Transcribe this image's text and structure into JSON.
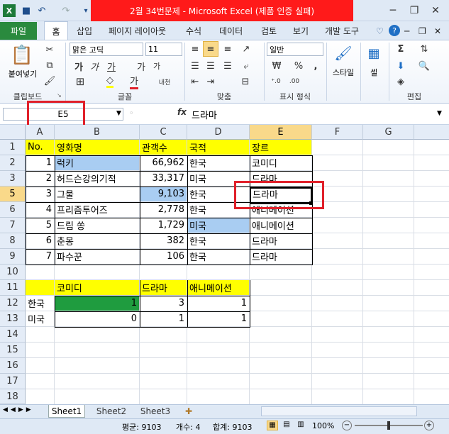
{
  "window": {
    "title": "2월 34번문제  -  Microsoft Excel (제품 인증 실패)",
    "min": "─",
    "restore": "❐",
    "close": "✕"
  },
  "qat": {
    "icons": [
      "excel-icon",
      "save-icon",
      "undo-icon",
      "redo-icon"
    ]
  },
  "tabs": {
    "file": "파일",
    "home": "홈",
    "insert": "삽입",
    "layout": "페이지 레이아웃",
    "formula": "수식",
    "data": "데이터",
    "review": "검토",
    "view": "보기",
    "dev": "개발 도구"
  },
  "ribbon": {
    "clipboard": {
      "paste": "붙여넣기",
      "label": "클립보드"
    },
    "font": {
      "name": "맑은 고딕",
      "size": "11",
      "bold": "가",
      "italic": "가",
      "underline": "가",
      "grow": "가",
      "shrink": "가",
      "color": "가",
      "phonetic": "내천",
      "label": "글꼴"
    },
    "align": {
      "label": "맞춤"
    },
    "number": {
      "format": "일반",
      "percent": "%",
      "comma": ",",
      "label": "표시 형식"
    },
    "style": {
      "label": "스타일"
    },
    "cells": {
      "label": "셀"
    },
    "edit": {
      "label": "편집",
      "sum": "Σ"
    }
  },
  "formula_bar": {
    "name_box": "E5",
    "fx": "fx",
    "content": "드라마"
  },
  "columns": [
    "A",
    "B",
    "C",
    "D",
    "E",
    "F",
    "G"
  ],
  "rows": [
    "1",
    "2",
    "3",
    "4",
    "5",
    "6",
    "7",
    "8",
    "9",
    "10",
    "11",
    "12",
    "13",
    "14",
    "15",
    "16",
    "17",
    "18"
  ],
  "table1": {
    "headers": [
      "No.",
      "영화명",
      "관객수",
      "국적",
      "장르"
    ],
    "rows": [
      [
        "1",
        "럭키",
        "66,962",
        "한국",
        "코미디"
      ],
      [
        "2",
        "허드슨강의기적",
        "33,317",
        "미국",
        "드라마"
      ],
      [
        "3",
        "그물",
        "9,103",
        "한국",
        "드라마"
      ],
      [
        "4",
        "프리즘투어즈",
        "2,778",
        "한국",
        "애니메이션"
      ],
      [
        "5",
        "드림 쏭",
        "1,729",
        "미국",
        "애니메이션"
      ],
      [
        "6",
        "춘몽",
        "382",
        "한국",
        "드라마"
      ],
      [
        "7",
        "파수꾼",
        "106",
        "한국",
        "드라마"
      ]
    ]
  },
  "table2": {
    "headers": [
      "코미디",
      "드라마",
      "애니메이션"
    ],
    "rows": [
      {
        "label": "한국",
        "values": [
          "1",
          "3",
          "1"
        ]
      },
      {
        "label": "미국",
        "values": [
          "0",
          "1",
          "1"
        ]
      }
    ]
  },
  "sheets": [
    "Sheet1",
    "Sheet2",
    "Sheet3"
  ],
  "status": {
    "average": "평균: 9103",
    "count": "개수: 4",
    "sum": "합계: 9103",
    "zoom": "100%",
    "zoom_minus": "−",
    "zoom_plus": "+"
  }
}
